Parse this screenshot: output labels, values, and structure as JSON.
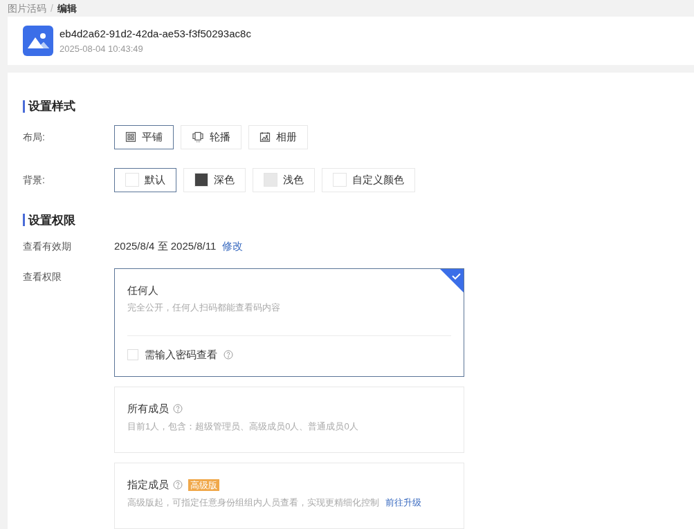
{
  "breadcrumb_separator": "/",
  "breadcrumb": [
    {
      "label": "图片活码",
      "current": false
    },
    {
      "label": "编辑",
      "current": true
    }
  ],
  "header": {
    "title": "eb4d2a62-91d2-42da-ae53-f3f50293ac8c",
    "time": "2025-08-04 10:43:49"
  },
  "style_section": {
    "title": "设置样式",
    "layout": {
      "label": "布局:",
      "options": [
        {
          "label": "平铺",
          "kind": "grid",
          "selected": true
        },
        {
          "label": "轮播",
          "kind": "carousel",
          "selected": false
        },
        {
          "label": "相册",
          "kind": "album",
          "selected": false
        }
      ]
    },
    "background": {
      "label": "背景:",
      "options": [
        {
          "label": "默认",
          "color": "#ffffff",
          "selected": true
        },
        {
          "label": "深色",
          "color": "#444444",
          "selected": false
        },
        {
          "label": "浅色",
          "color": "#e8e8e8",
          "selected": false
        },
        {
          "label": "自定义颜色",
          "color": "#ffffff",
          "selected": false
        }
      ]
    }
  },
  "permission_section": {
    "title": "设置权限",
    "validity": {
      "label": "查看有效期",
      "value": "2025/8/4 至 2025/8/11",
      "link": "修改"
    },
    "access": {
      "label": "查看权限",
      "options": [
        {
          "title": "任何人",
          "description": "完全公开，任何人扫码都能查看码内容",
          "selected": true,
          "help": false,
          "password": {
            "label": "需输入密码查看",
            "checked": false
          }
        },
        {
          "title": "所有成员",
          "description": "目前1人，包含：超级管理员、高级成员0人、普通成员0人",
          "selected": false,
          "help": true
        },
        {
          "title": "指定成员",
          "description": "高级版起，可指定任意身份组组内人员查看，实现更精细化控制",
          "selected": false,
          "help": true,
          "badge": "高级版",
          "link": "前往升级"
        }
      ]
    }
  }
}
